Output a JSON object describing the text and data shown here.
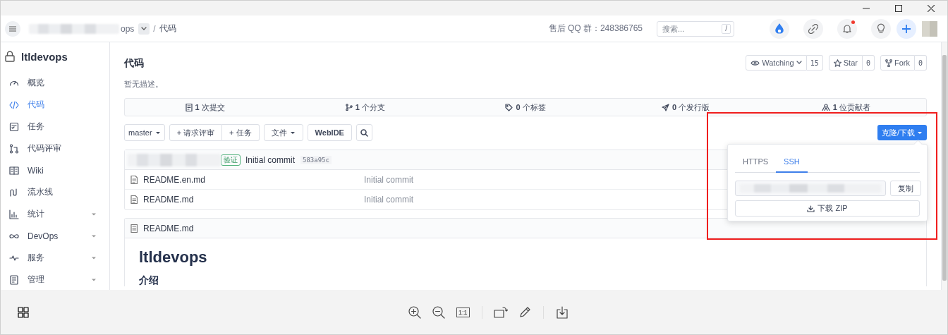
{
  "topnav": {
    "breadcrumb_tail": "ops",
    "separator": "/",
    "page": "代码",
    "qq": "售后 QQ 群：248386765",
    "search": {
      "placeholder": "搜索...",
      "shortcut": "/"
    },
    "notification_dot": true
  },
  "sidebar": {
    "repo": "ltldevops",
    "items": [
      {
        "label": "概览",
        "selected": false,
        "expandable": false
      },
      {
        "label": "代码",
        "selected": true,
        "expandable": false
      },
      {
        "label": "任务",
        "selected": false,
        "expandable": false
      },
      {
        "label": "代码评审",
        "selected": false,
        "expandable": false
      },
      {
        "label": "Wiki",
        "selected": false,
        "expandable": false
      },
      {
        "label": "流水线",
        "selected": false,
        "expandable": false
      },
      {
        "label": "统计",
        "selected": false,
        "expandable": true
      },
      {
        "label": "DevOps",
        "selected": false,
        "expandable": true
      },
      {
        "label": "服务",
        "selected": false,
        "expandable": true
      },
      {
        "label": "管理",
        "selected": false,
        "expandable": true
      }
    ]
  },
  "repo": {
    "title": "代码",
    "description": "暂无描述。",
    "watch": {
      "label": "Watching",
      "count": "15"
    },
    "star": {
      "label": "Star",
      "count": "0"
    },
    "fork": {
      "label": "Fork",
      "count": "0"
    },
    "stats": [
      "**1** 次提交",
      "**1** 个分支",
      "**0** 个标签",
      "**0** 个发行版",
      "**1** 位贡献者"
    ],
    "toolbar": {
      "branch": "master",
      "review": "+ 请求评审",
      "task": "+ 任务",
      "files": "文件",
      "webide": "WebIDE",
      "clone": "克隆/下载"
    },
    "commit": {
      "badge": "验证",
      "message": "Initial commit",
      "hash": "583a95c"
    },
    "files": [
      {
        "name": "README.en.md",
        "commit": "Initial commit"
      },
      {
        "name": "README.md",
        "commit": "Initial commit"
      }
    ],
    "readme": {
      "filename": "README.md",
      "heading": "ltldevops",
      "subheading": "介绍"
    }
  },
  "clone_popup": {
    "tabs": [
      {
        "label": "HTTPS",
        "selected": false
      },
      {
        "label": "SSH",
        "selected": true
      }
    ],
    "copy": "复制",
    "download": "下载 ZIP"
  },
  "viewer_toolbar": {
    "actual_size": "1:1"
  }
}
